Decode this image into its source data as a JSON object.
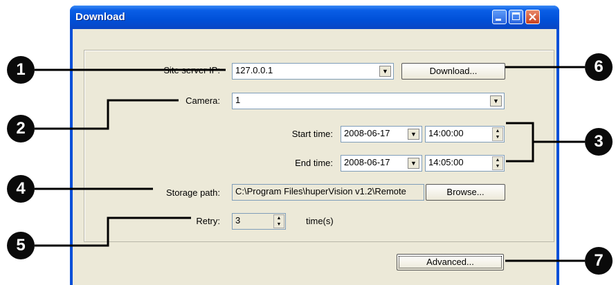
{
  "window": {
    "title": "Download"
  },
  "form": {
    "site_server_ip": {
      "label": "Site server IP:",
      "value": "127.0.0.1"
    },
    "download_button": "Download...",
    "camera": {
      "label": "Camera:",
      "value": "1"
    },
    "start_time": {
      "label": "Start time:",
      "date": "2008-06-17",
      "time": "14:00:00"
    },
    "end_time": {
      "label": "End time:",
      "date": "2008-06-17",
      "time": "14:05:00"
    },
    "storage_path": {
      "label": "Storage path:",
      "value": "C:\\Program Files\\huperVision v1.2\\Remote"
    },
    "browse_button": "Browse...",
    "retry": {
      "label": "Retry:",
      "value": "3",
      "unit": "time(s)"
    },
    "advanced_button": "Advanced..."
  },
  "callouts": [
    "1",
    "2",
    "3",
    "4",
    "5",
    "6",
    "7"
  ]
}
